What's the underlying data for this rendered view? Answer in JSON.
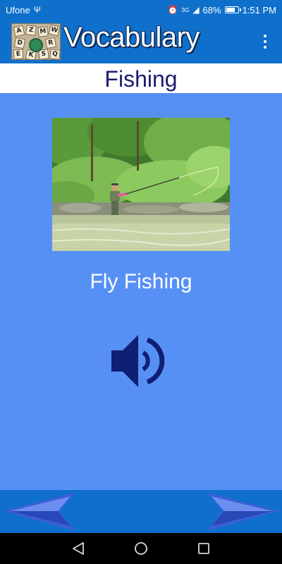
{
  "status_bar": {
    "carrier": "Ufone",
    "network_badge": "3G",
    "battery_percent": "68%",
    "time": "1:51 PM",
    "icons": [
      "usb-icon",
      "alarm-icon",
      "signal-icon",
      "battery-icon"
    ]
  },
  "app_bar": {
    "title": "Vocabulary",
    "logo_icon": "letter-tiles-logo",
    "menu_icon": "overflow-menu-icon"
  },
  "category": {
    "title": "Fishing"
  },
  "card": {
    "image_icon": "fly-fishing-photo",
    "word": "Fly Fishing",
    "speaker_icon": "speaker-icon"
  },
  "navigation": {
    "prev_icon": "left-arrow-icon",
    "next_icon": "right-arrow-icon"
  },
  "system_nav": {
    "icons": [
      "back-icon",
      "home-icon",
      "recents-icon"
    ]
  },
  "colors": {
    "background": "#5790f5",
    "app_bar": "#0f70cc",
    "category_text": "#1c1c70",
    "speaker": "#0f1f73",
    "arrow": "#3a5fd6"
  }
}
